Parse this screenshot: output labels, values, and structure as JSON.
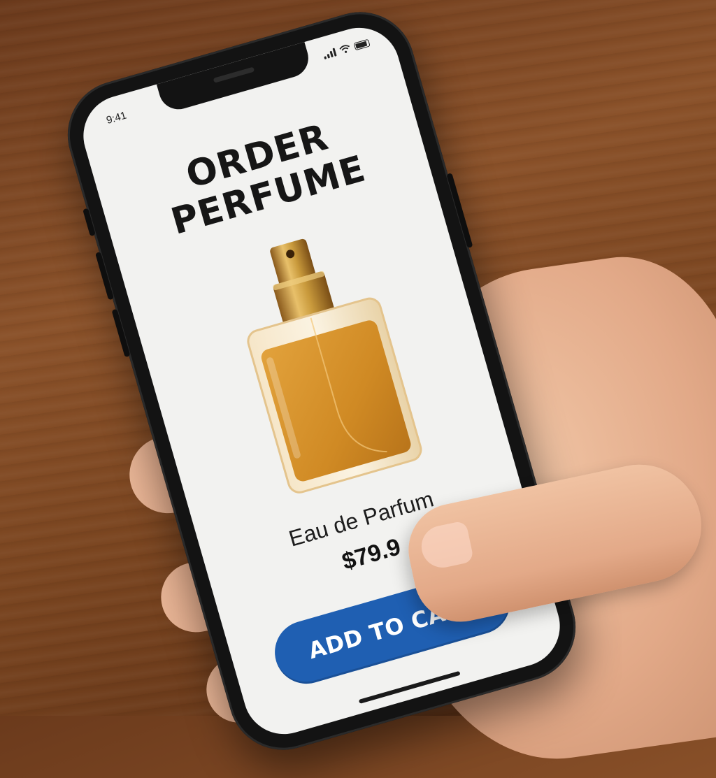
{
  "status_bar": {
    "time": "9:41",
    "icons": [
      "signal-icon",
      "wifi-icon",
      "battery-icon"
    ]
  },
  "page": {
    "title_line1": "ORDER",
    "title_line2": "PERFUME"
  },
  "product": {
    "image_icon": "perfume-bottle-icon",
    "name": "Eau de Parfum",
    "price": "$79.9"
  },
  "actions": {
    "add_to_cart_label": "ADD TO CART"
  },
  "colors": {
    "button": "#1f5fb2",
    "screen_bg": "#f2f2f0",
    "liquid": "#d99530",
    "cap": "#c99a3c"
  }
}
